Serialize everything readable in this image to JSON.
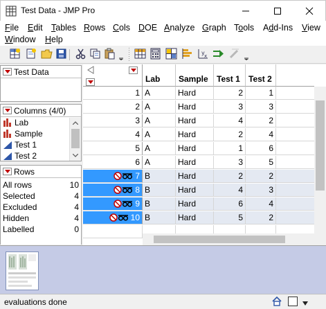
{
  "window": {
    "title": "Test Data - JMP Pro"
  },
  "menu": [
    "File",
    "Edit",
    "Tables",
    "Rows",
    "Cols",
    "DOE",
    "Analyze",
    "Graph",
    "Tools",
    "Add-Ins",
    "View",
    "Window",
    "Help"
  ],
  "menu_underline": [
    "F",
    "E",
    "T",
    "R",
    "C",
    "D",
    "A",
    "G",
    "o",
    "d",
    "V",
    "W",
    "H"
  ],
  "table_panel": {
    "label": "Test Data"
  },
  "columns_panel": {
    "label": "Columns (4/0)",
    "items": [
      {
        "name": "Lab",
        "icon": "nominal-bar-icon"
      },
      {
        "name": "Sample",
        "icon": "nominal-bar-icon"
      },
      {
        "name": "Test 1",
        "icon": "continuous-triangle-icon"
      },
      {
        "name": "Test 2",
        "icon": "continuous-triangle-icon"
      }
    ]
  },
  "rows_panel": {
    "label": "Rows",
    "stats": [
      {
        "label": "All rows",
        "value": "10"
      },
      {
        "label": "Selected",
        "value": "4"
      },
      {
        "label": "Excluded",
        "value": "4"
      },
      {
        "label": "Hidden",
        "value": "4"
      },
      {
        "label": "Labelled",
        "value": "0"
      }
    ]
  },
  "grid": {
    "columns": [
      "Lab",
      "Sample",
      "Test 1",
      "Test 2"
    ],
    "rows": [
      {
        "n": "1",
        "selected": false,
        "cells": [
          "A",
          "Hard",
          "2",
          "1"
        ]
      },
      {
        "n": "2",
        "selected": false,
        "cells": [
          "A",
          "Hard",
          "3",
          "3"
        ]
      },
      {
        "n": "3",
        "selected": false,
        "cells": [
          "A",
          "Hard",
          "4",
          "2"
        ]
      },
      {
        "n": "4",
        "selected": false,
        "cells": [
          "A",
          "Hard",
          "2",
          "4"
        ]
      },
      {
        "n": "5",
        "selected": false,
        "cells": [
          "A",
          "Hard",
          "1",
          "6"
        ]
      },
      {
        "n": "6",
        "selected": false,
        "cells": [
          "A",
          "Hard",
          "3",
          "5"
        ]
      },
      {
        "n": "7",
        "selected": true,
        "cells": [
          "B",
          "Hard",
          "2",
          "2"
        ]
      },
      {
        "n": "8",
        "selected": true,
        "cells": [
          "B",
          "Hard",
          "4",
          "3"
        ]
      },
      {
        "n": "9",
        "selected": true,
        "cells": [
          "B",
          "Hard",
          "6",
          "4"
        ]
      },
      {
        "n": "10",
        "selected": true,
        "cells": [
          "B",
          "Hard",
          "5",
          "2"
        ]
      }
    ]
  },
  "status": {
    "text": "evaluations done"
  },
  "colors": {
    "selection": "#3399ff",
    "selected_cell": "#e4e9f2",
    "thumb_area": "#c5cbe6",
    "red_triangle": "#c00000"
  }
}
